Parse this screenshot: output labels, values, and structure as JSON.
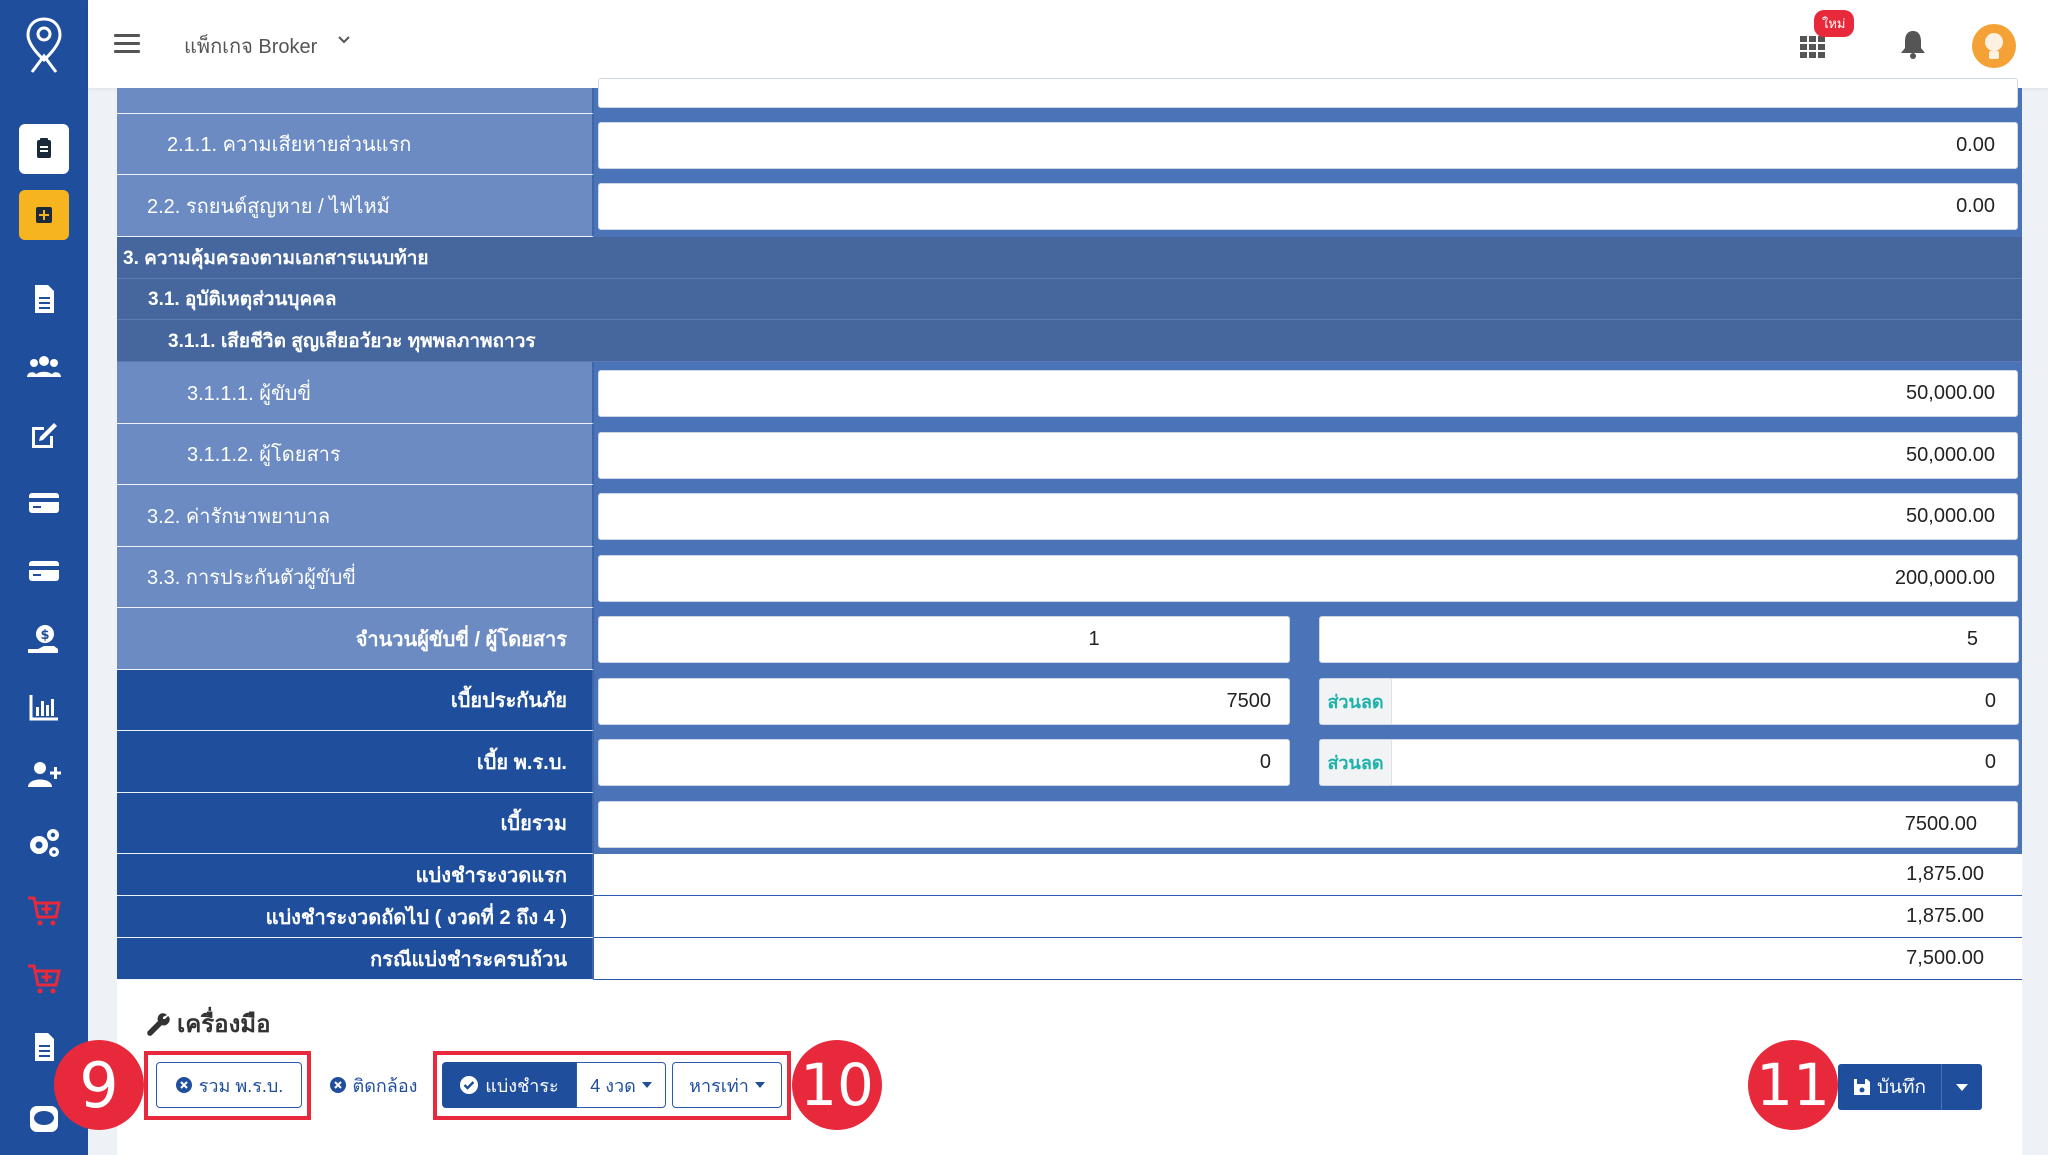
{
  "topbar": {
    "package_label": "แพ็กเกจ Broker",
    "new_badge": "ใหม่"
  },
  "coverage": {
    "r211": {
      "label": "2.1.1. ความเสียหายส่วนแรก",
      "value": "0.00"
    },
    "r22": {
      "label": "2.2. รถยนต์สูญหาย / ไฟไหม้",
      "value": "0.00"
    },
    "h3": "3. ความคุ้มครองตามเอกสารแนบท้าย",
    "h31": "3.1. อุบัติเหตุส่วนบุคคล",
    "h311": "3.1.1. เสียชีวิต สูญเสียอวัยวะ ทุพพลภาพถาวร",
    "r3111": {
      "label": "3.1.1.1. ผู้ขับขี่",
      "value": "50,000.00"
    },
    "r3112": {
      "label": "3.1.1.2. ผู้โดยสาร",
      "value": "50,000.00"
    },
    "r32": {
      "label": "3.2. ค่ารักษาพยาบาล",
      "value": "50,000.00"
    },
    "r33": {
      "label": "3.3. การประกันตัวผู้ขับขี่",
      "value": "200,000.00"
    },
    "people": {
      "label": "จำนวนผู้ขับขี่ / ผู้โดยสาร",
      "drivers": "1",
      "passengers": "5"
    }
  },
  "premium": {
    "premium_label": "เบี้ยประกันภัย",
    "premium_value": "7500",
    "discount_label": "ส่วนลด",
    "premium_discount": "0",
    "compulsory_label": "เบี้ย พ.ร.บ.",
    "compulsory_value": "0",
    "compulsory_discount": "0",
    "total_label": "เบี้ยรวม",
    "total_value": "7500.00",
    "first_label": "แบ่งชำระงวดแรก",
    "first_value": "1,875.00",
    "next_label": "แบ่งชำระงวดถัดไป ( งวดที่ 2 ถึง 4 )",
    "next_value": "1,875.00",
    "full_label": "กรณีแบ่งชำระครบถ้วน",
    "full_value": "7,500.00"
  },
  "tools": {
    "title": "เครื่องมือ",
    "include_compulsory": "รวม พ.ร.บ.",
    "camera": "ติดกล้อง",
    "installment": "แบ่งชำระ",
    "installment_count": "4 งวด",
    "divide_equal": "หารเท่า",
    "save": "บันทึก"
  },
  "steps": {
    "s9": "9",
    "s10": "10",
    "s11": "11"
  },
  "colors": {
    "primary": "#1f4e9c",
    "label_bg": "#6b8bc2",
    "accent_red": "#e8293b",
    "sidebar_active": "#f6b51f",
    "discount_text": "#20b2aa"
  }
}
